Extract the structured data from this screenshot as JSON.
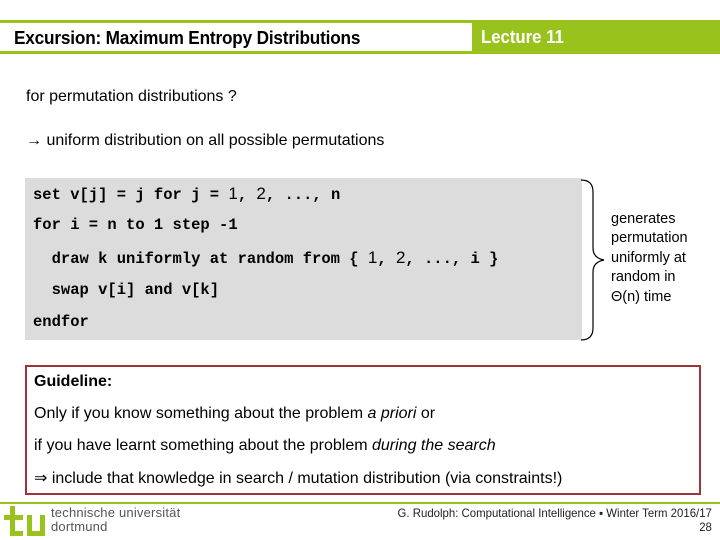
{
  "header": {
    "title": "Excursion: Maximum Entropy Distributions",
    "lecture": "Lecture 11",
    "accent_color": "#99c31c"
  },
  "body": {
    "question": "for permutation distributions ?",
    "answer": "→ uniform distribution on all possible permutations"
  },
  "code": {
    "lines": [
      {
        "pre": "set v[j] = j for j = ",
        "n1": "1",
        "s1": ", ",
        "n2": "2",
        "post": ", ..., n"
      },
      {
        "text": "for i = n to 1 step -1"
      },
      {
        "pre": "  draw k uniformly at random from { ",
        "n1": "1",
        "s1": ", ",
        "n2": "2",
        "post": ", ..., i }"
      },
      {
        "text": "  swap v[i] and v[k]"
      },
      {
        "text": "endfor"
      }
    ],
    "annotation": [
      "generates",
      "permutation",
      "uniformly at",
      "random in",
      "Θ(n) time"
    ]
  },
  "guideline": {
    "title": "Guideline:",
    "line1_pre": "Only if you know something about the problem ",
    "line1_em": "a priori",
    "line1_post": " or",
    "line2_pre": "if you have learnt something about the problem ",
    "line2_em": "during the search",
    "line3": "⇒ include that knowledge in search / mutation distribution (via constraints!)",
    "border_color": "#a0323c"
  },
  "footer": {
    "university_line1": "technische universität",
    "university_line2": "dortmund",
    "credit": "G. Rudolph: Computational Intelligence ▪ Winter Term 2016/17",
    "page_number": "28"
  }
}
